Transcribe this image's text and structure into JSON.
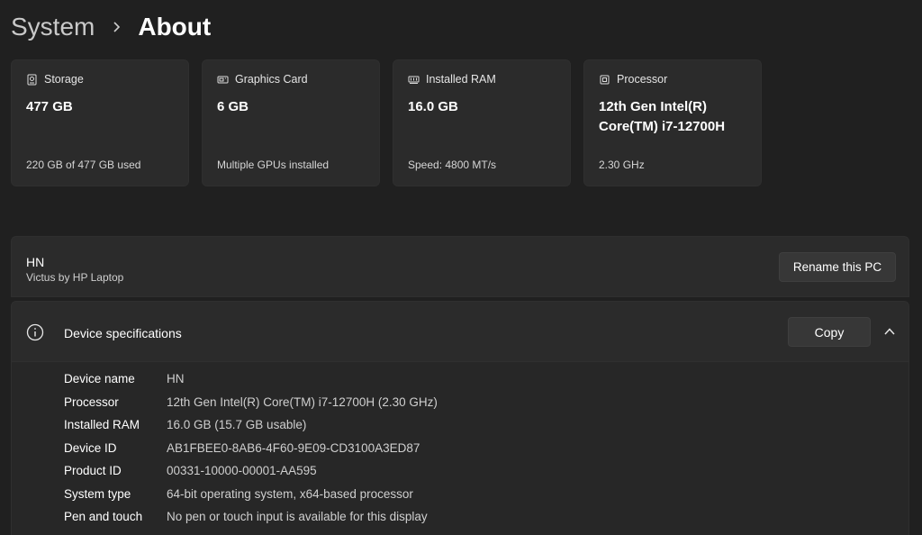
{
  "breadcrumb": {
    "parent": "System",
    "current": "About"
  },
  "cards": [
    {
      "icon": "storage-icon",
      "label": "Storage",
      "value": "477 GB",
      "sub": "220 GB of 477 GB used"
    },
    {
      "icon": "graphics-card-icon",
      "label": "Graphics Card",
      "value": "6 GB",
      "sub": "Multiple GPUs installed"
    },
    {
      "icon": "ram-icon",
      "label": "Installed RAM",
      "value": "16.0 GB",
      "sub": "Speed: 4800 MT/s"
    },
    {
      "icon": "processor-icon",
      "label": "Processor",
      "value": "12th Gen Intel(R) Core(TM) i7-12700H",
      "sub": "2.30 GHz"
    }
  ],
  "device": {
    "name": "HN",
    "model": "Victus by HP Laptop",
    "rename_label": "Rename this PC"
  },
  "specs": {
    "title": "Device specifications",
    "copy_label": "Copy",
    "rows": [
      {
        "label": "Device name",
        "value": "HN"
      },
      {
        "label": "Processor",
        "value": "12th Gen Intel(R) Core(TM) i7-12700H (2.30 GHz)"
      },
      {
        "label": "Installed RAM",
        "value": "16.0 GB (15.7 GB usable)"
      },
      {
        "label": "Device ID",
        "value": "AB1FBEE0-8AB6-4F60-9E09-CD3100A3ED87"
      },
      {
        "label": "Product ID",
        "value": "00331-10000-00001-AA595"
      },
      {
        "label": "System type",
        "value": "64-bit operating system, x64-based processor"
      },
      {
        "label": "Pen and touch",
        "value": "No pen or touch input is available for this display"
      }
    ]
  }
}
